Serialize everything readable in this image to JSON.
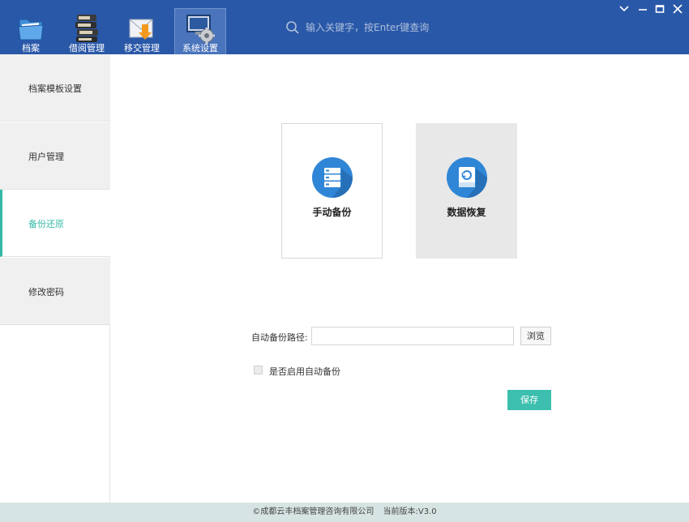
{
  "header": {
    "nav": [
      {
        "label": "档案",
        "icon": "folder-icon"
      },
      {
        "label": "借阅管理",
        "icon": "book-stack-icon"
      },
      {
        "label": "移交管理",
        "icon": "mail-download-icon"
      },
      {
        "label": "系统设置",
        "icon": "system-settings-icon"
      }
    ],
    "active_nav": "系统设置",
    "search": {
      "placeholder": "输入关键字，按Enter键查询"
    }
  },
  "sidebar": {
    "items": [
      {
        "label": "档案模板设置"
      },
      {
        "label": "用户管理"
      },
      {
        "label": "备份还原"
      },
      {
        "label": "修改密码"
      }
    ],
    "active": "备份还原"
  },
  "main": {
    "cards": [
      {
        "label": "手动备份",
        "icon": "server-icon"
      },
      {
        "label": "数据恢复",
        "icon": "disk-restore-icon"
      }
    ],
    "auto_backup": {
      "path_label": "自动备份路径:",
      "path_value": "",
      "browse_label": "浏览",
      "enable_label": "是否启用自动备份",
      "enabled": false,
      "save_label": "保存"
    }
  },
  "footer": {
    "copyright": "©成都云丰档案管理咨询有限公司",
    "version": "当前版本:V3.0"
  },
  "colors": {
    "header_bg": "#2a58a8",
    "accent": "#3cbfae",
    "sidebar_bg": "#f0f0f0",
    "footer_bg": "#d6e4e3",
    "icon_blue": "#2f86d6"
  }
}
